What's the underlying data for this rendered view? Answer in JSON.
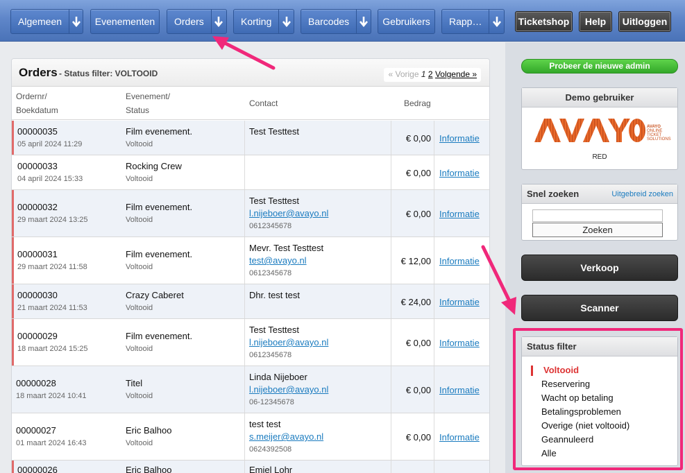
{
  "nav": {
    "items": [
      {
        "label": "Algemeen",
        "dropdown": true
      },
      {
        "label": "Evenementen",
        "dropdown": false
      },
      {
        "label": "Orders",
        "dropdown": true
      },
      {
        "label": "Korting",
        "dropdown": true
      },
      {
        "label": "Barcodes",
        "dropdown": true
      },
      {
        "label": "Gebruikers",
        "dropdown": false
      },
      {
        "label": "Rapp…",
        "dropdown": true
      }
    ],
    "ticketshop": "Ticketshop",
    "help": "Help",
    "logout": "Uitloggen"
  },
  "orders": {
    "title": "Orders",
    "subtitle": "- Status filter: VOLTOOID",
    "pager": {
      "prev": "« Vorige",
      "page_current": "1",
      "page_next": "2",
      "next": "Volgende »"
    },
    "columns": {
      "order_line1": "Ordernr/",
      "order_line2": "Boekdatum",
      "event_line1": "Evenement/",
      "event_line2": "Status",
      "contact": "Contact",
      "amount": "Bedrag"
    },
    "rows": [
      {
        "nr": "00000035",
        "date": "05 april 2024 11:29",
        "event": "Film evenement.",
        "status": "Voltooid",
        "contact": "Test Testtest",
        "email": "",
        "phone": "",
        "amount": "€ 0,00",
        "link": "Informatie"
      },
      {
        "nr": "00000033",
        "date": "04 april 2024 15:33",
        "event": "Rocking Crew",
        "status": "Voltooid",
        "contact": "",
        "email": "",
        "phone": "",
        "amount": "€ 0,00",
        "link": "Informatie"
      },
      {
        "nr": "00000032",
        "date": "29 maart 2024 13:25",
        "event": "Film evenement.",
        "status": "Voltooid",
        "contact": "Test Testtest",
        "email": "l.nijeboer@avayo.nl",
        "phone": "0612345678",
        "amount": "€ 0,00",
        "link": "Informatie"
      },
      {
        "nr": "00000031",
        "date": "29 maart 2024 11:58",
        "event": "Film evenement.",
        "status": "Voltooid",
        "contact": "Mevr. Test Testtest",
        "email": "test@avayo.nl",
        "phone": "0612345678",
        "amount": "€ 12,00",
        "link": "Informatie"
      },
      {
        "nr": "00000030",
        "date": "21 maart 2024 11:53",
        "event": "Crazy Caberet",
        "status": "Voltooid",
        "contact": "Dhr. test test",
        "email": "",
        "phone": "",
        "amount": "€ 24,00",
        "link": "Informatie"
      },
      {
        "nr": "00000029",
        "date": "18 maart 2024 15:25",
        "event": "Film evenement.",
        "status": "Voltooid",
        "contact": "Test Testtest",
        "email": "l.nijeboer@avayo.nl",
        "phone": "0612345678",
        "amount": "€ 0,00",
        "link": "Informatie"
      },
      {
        "nr": "00000028",
        "date": "18 maart 2024 10:41",
        "event": "Titel",
        "status": "Voltooid",
        "contact": "Linda Nijeboer",
        "email": "l.nijeboer@avayo.nl",
        "phone": "06-12345678",
        "amount": "€ 0,00",
        "link": "Informatie"
      },
      {
        "nr": "00000027",
        "date": "01 maart 2024 16:43",
        "event": "Eric Balhoo",
        "status": "Voltooid",
        "contact": "test test",
        "email": "s.meijer@avayo.nl",
        "phone": "0624392508",
        "amount": "€ 0,00",
        "link": "Informatie"
      },
      {
        "nr": "00000026",
        "date": "",
        "event": "Eric Balhoo",
        "status": "",
        "contact": "Emiel Lohr",
        "email": "",
        "phone": "",
        "amount": "",
        "link": ""
      }
    ]
  },
  "sidebar": {
    "new_admin": "Probeer de nieuwe admin",
    "demo_title": "Demo gebruiker",
    "logo_text": "AVAYO",
    "logo_tag": [
      "AVAYO",
      "ONLINE",
      "TICKET",
      "SOLUTIONS"
    ],
    "demo_label": "RED",
    "quick_title": "Snel zoeken",
    "quick_link": "Uitgebreid zoeken",
    "search_value": "",
    "search_button": "Zoeken",
    "sales_button": "Verkoop",
    "scanner_button": "Scanner",
    "filter_title": "Status filter",
    "filters": [
      "Voltooid",
      "Reservering",
      "Wacht op betaling",
      "Betalingsproblemen",
      "Overige (niet voltooid)",
      "Geannuleerd",
      "Alle"
    ]
  },
  "colors": {
    "accent": "#4a73b8",
    "annotation": "#f0287a",
    "link": "#1a7bbf",
    "active_filter": "#dd3333"
  }
}
